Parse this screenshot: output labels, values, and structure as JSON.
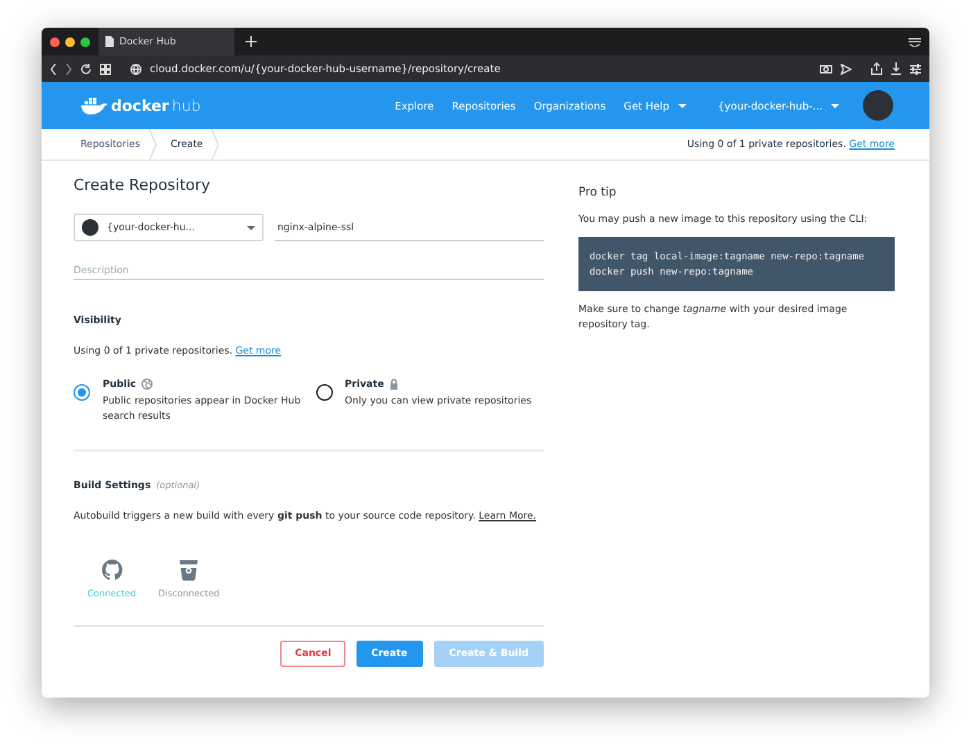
{
  "browser": {
    "tab_title": "Docker Hub",
    "url": "cloud.docker.com/u/{your-docker-hub-username}/repository/create"
  },
  "nav": {
    "logo": [
      "docker",
      "hub"
    ],
    "items": [
      {
        "label": "Explore",
        "dropdown": false
      },
      {
        "label": "Repositories",
        "dropdown": false
      },
      {
        "label": "Organizations",
        "dropdown": false
      },
      {
        "label": "Get Help",
        "dropdown": true
      }
    ],
    "user": "{your-docker-hub-..."
  },
  "breadcrumb": {
    "items": [
      {
        "label": "Repositories",
        "selected": false
      },
      {
        "label": "Create",
        "selected": true
      }
    ],
    "usage": "Using 0 of 1 private repositories.",
    "link": "Get more"
  },
  "form": {
    "title": "Create Repository",
    "namespace": "{your-docker-hu...",
    "name": "nginx-alpine-ssl",
    "description_placeholder": "Description"
  },
  "visibility": {
    "heading": "Visibility",
    "usage": "Using 0 of 1 private repositories.",
    "link": "Get more",
    "options": [
      {
        "label": "Public",
        "description": "Public repositories appear in Docker Hub search results",
        "selected": true
      },
      {
        "label": "Private",
        "description": "Only you can view private repositories",
        "selected": false
      }
    ]
  },
  "build": {
    "heading": "Build Settings",
    "note": "(optional)",
    "text": "Autobuild triggers a new build with every **git push** to your source code repository.",
    "link": "Learn More.",
    "providers": [
      {
        "label": "Connected",
        "connected": true
      },
      {
        "label": "Disconnected",
        "connected": false
      }
    ]
  },
  "buttons": [
    {
      "label": "Cancel",
      "kind": "outline",
      "disabled": false
    },
    {
      "label": "Create",
      "kind": "primary",
      "disabled": false
    },
    {
      "label": "Create & Build",
      "kind": "primary",
      "disabled": true
    }
  ],
  "pro_tip": {
    "title": "Pro tip",
    "intro": "You may push a new image to this repository using the CLI:",
    "code": [
      "docker tag local-image:tagname new-repo:tagname",
      "docker push new-repo:tagname"
    ],
    "note": "Make sure to change *tagname* with your desired image repository tag."
  }
}
